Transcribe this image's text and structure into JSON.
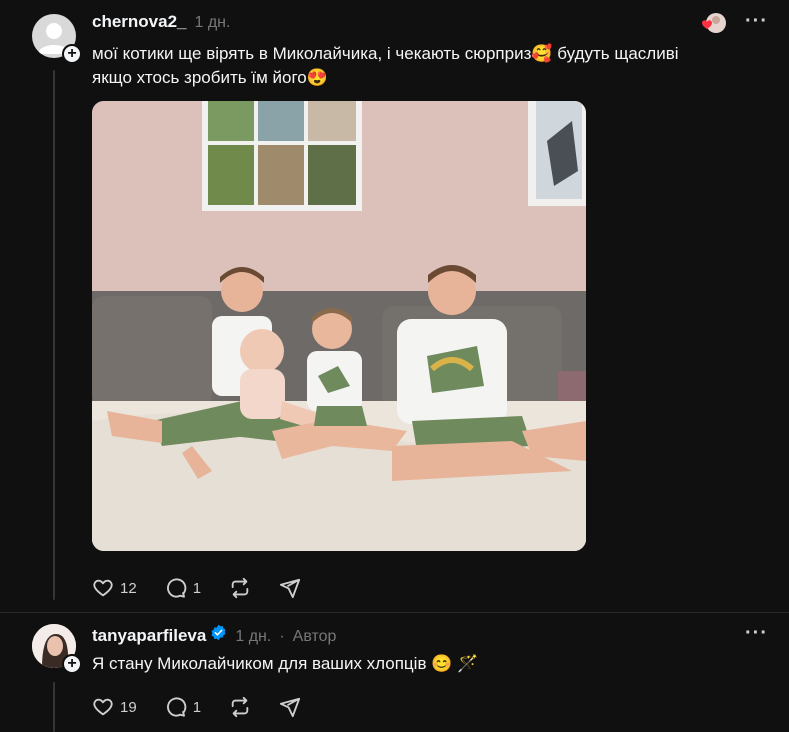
{
  "post1": {
    "username": "chernova2_",
    "time": "1 дн.",
    "text_line1": "мої котики ще вірять в Миколайчика, і чекають сюрприз",
    "emoji1": "🥰",
    "text_line1b": " будуть щасливі",
    "text_line2": "якщо хтось зробить їм його",
    "emoji2": "😍",
    "more_label": "···",
    "likes": "12",
    "comments": "1"
  },
  "post2": {
    "username": "tanyaparfileva",
    "time": "1 дн.",
    "separator": "·",
    "author_label": "Автор",
    "text": "Я стану Миколайчиком для ваших хлопців ",
    "emoji": "😊",
    "emoji2": "🪄",
    "more_label": "···",
    "likes": "19",
    "comments": "1"
  },
  "colors": {
    "background": "#101010",
    "text": "#f3f5f7",
    "muted": "#777777",
    "verified": "#0095f6",
    "heart": "#ff3040"
  },
  "icons": [
    "heart-icon",
    "comment-icon",
    "repost-icon",
    "share-icon",
    "verified-icon",
    "plus-icon",
    "more-icon"
  ]
}
